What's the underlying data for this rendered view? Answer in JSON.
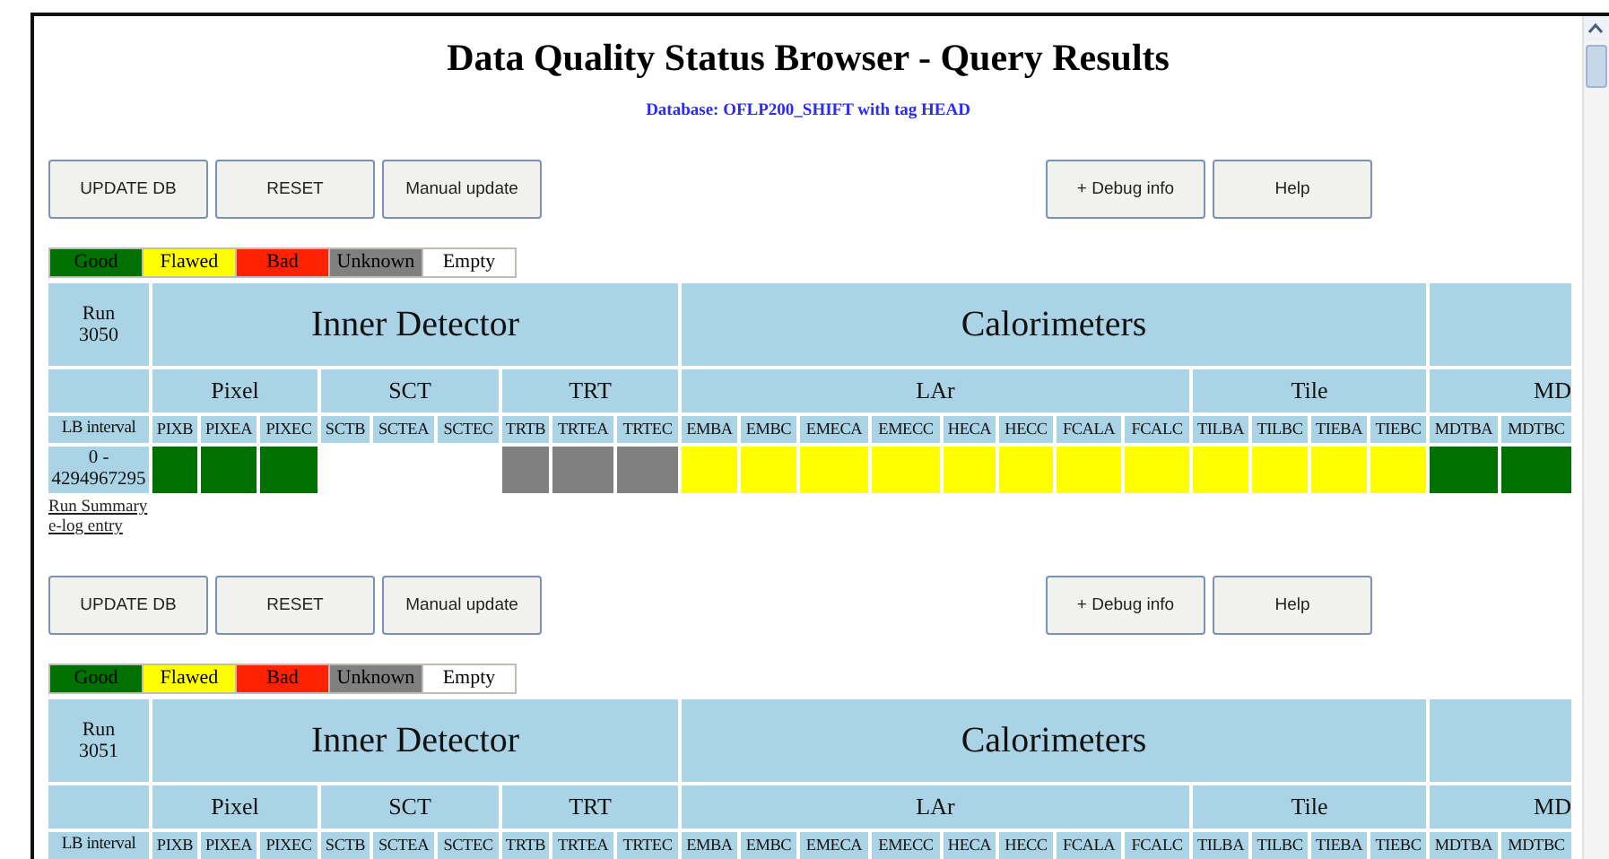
{
  "title": "Data Quality Status Browser - Query Results",
  "database": "Database: OFLP200_SHIFT with tag HEAD",
  "runs": [
    {
      "buttons_left": [
        "UPDATE DB",
        "RESET",
        "Manual update"
      ],
      "buttons_right": [
        "+ Debug info",
        "Help"
      ],
      "legend": [
        {
          "label": "Good",
          "color": "#007000"
        },
        {
          "label": "Flawed",
          "color": "#ffff00"
        },
        {
          "label": "Bad",
          "color": "#ff2200"
        },
        {
          "label": "Unknown",
          "color": "#808080"
        },
        {
          "label": "Empty",
          "color": "#ffffff"
        }
      ],
      "run": "Run 3050",
      "systems": [
        {
          "name": "Inner Detector",
          "subsystems": [
            {
              "name": "Pixel",
              "channels": [
                "PIXB",
                "PIXEA",
                "PIXEC"
              ]
            },
            {
              "name": "SCT",
              "channels": [
                "SCTB",
                "SCTEA",
                "SCTEC"
              ]
            },
            {
              "name": "TRT",
              "channels": [
                "TRTB",
                "TRTEA",
                "TRTEC"
              ]
            }
          ]
        },
        {
          "name": "Calorimeters",
          "subsystems": [
            {
              "name": "LAr",
              "channels": [
                "EMBA",
                "EMBC",
                "EMECA",
                "EMECC",
                "HECA",
                "HECC",
                "FCALA",
                "FCALC"
              ]
            },
            {
              "name": "Tile",
              "channels": [
                "TILBA",
                "TILBC",
                "TIEBA",
                "TIEBC"
              ]
            }
          ]
        },
        {
          "subsystems": [
            {
              "name": "MD",
              "channels": [
                "MDTBA",
                "MDTBC"
              ]
            }
          ]
        }
      ],
      "interval_header": "LB interval",
      "rows": [
        {
          "interval": "0 - 4294967295",
          "cells": [
            {
              "color": "#007000"
            },
            {
              "color": "#007000"
            },
            {
              "color": "#007000"
            },
            {
              "color": "#ffffff"
            },
            {
              "color": "#ffffff"
            },
            {
              "color": "#ffffff"
            },
            {
              "color": "#808080"
            },
            {
              "color": "#808080"
            },
            {
              "color": "#808080"
            },
            {
              "color": "#ffff00"
            },
            {
              "color": "#ffff00"
            },
            {
              "color": "#ffff00"
            },
            {
              "color": "#ffff00"
            },
            {
              "color": "#ffff00"
            },
            {
              "color": "#ffff00"
            },
            {
              "color": "#ffff00"
            },
            {
              "color": "#ffff00"
            },
            {
              "color": "#ffff00"
            },
            {
              "color": "#ffff00"
            },
            {
              "color": "#ffff00"
            },
            {
              "color": "#ffff00"
            },
            {
              "color": "#007000"
            },
            {
              "color": "#007000"
            }
          ]
        }
      ],
      "links": [
        "Run Summary",
        "e-log entry"
      ]
    },
    {
      "buttons_left": [
        "UPDATE DB",
        "RESET",
        "Manual update"
      ],
      "buttons_right": [
        "+ Debug info",
        "Help"
      ],
      "legend": [
        {
          "label": "Good",
          "color": "#007000"
        },
        {
          "label": "Flawed",
          "color": "#ffff00"
        },
        {
          "label": "Bad",
          "color": "#ff2200"
        },
        {
          "label": "Unknown",
          "color": "#808080"
        },
        {
          "label": "Empty",
          "color": "#ffffff"
        }
      ],
      "run": "Run 3051",
      "systems": [
        {
          "name": "Inner Detector",
          "subsystems": [
            {
              "name": "Pixel",
              "channels": [
                "PIXB",
                "PIXEA",
                "PIXEC"
              ]
            },
            {
              "name": "SCT",
              "channels": [
                "SCTB",
                "SCTEA",
                "SCTEC"
              ]
            },
            {
              "name": "TRT",
              "channels": [
                "TRTB",
                "TRTEA",
                "TRTEC"
              ]
            }
          ]
        },
        {
          "name": "Calorimeters",
          "subsystems": [
            {
              "name": "LAr",
              "channels": [
                "EMBA",
                "EMBC",
                "EMECA",
                "EMECC",
                "HECA",
                "HECC",
                "FCALA",
                "FCALC"
              ]
            },
            {
              "name": "Tile",
              "channels": [
                "TILBA",
                "TILBC",
                "TIEBA",
                "TIEBC"
              ]
            }
          ]
        },
        {
          "subsystems": [
            {
              "name": "MD",
              "channels": [
                "MDTBA",
                "MDTBC"
              ]
            }
          ]
        }
      ],
      "interval_header": "LB interval"
    }
  ]
}
